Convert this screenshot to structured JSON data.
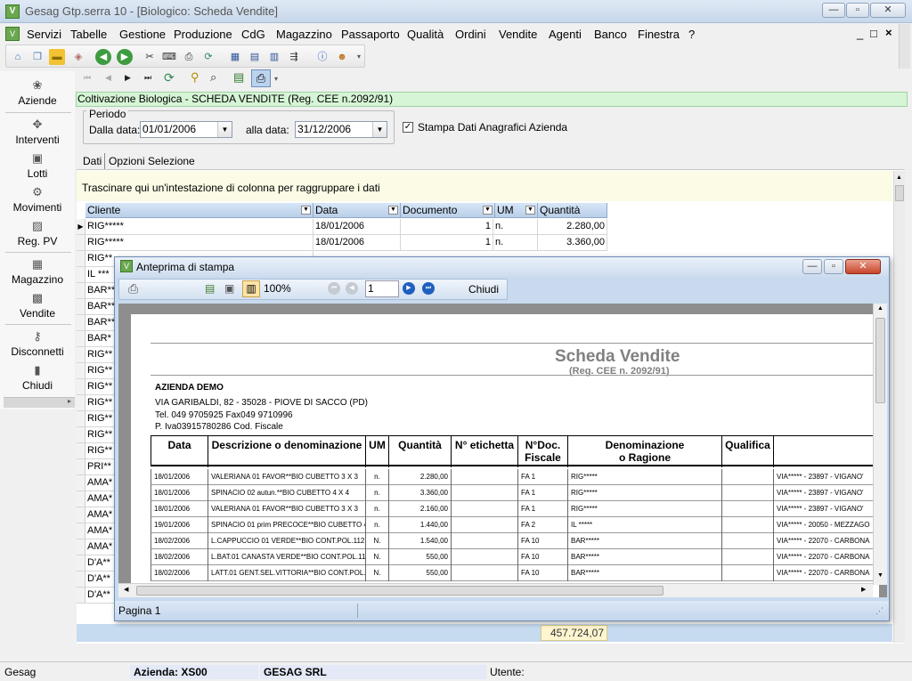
{
  "window": {
    "title": "Gesag Gtp.serra 10 - [Biologico: Scheda Vendite]",
    "mdi_controls": [
      "_",
      "□",
      "×"
    ]
  },
  "menu": [
    "Servizi",
    "Tabelle",
    "Gestione",
    "Produzione",
    "CdG",
    "Magazzino",
    "Passaporto",
    "Qualità",
    "Ordini",
    "Vendite",
    "Agenti",
    "Banco",
    "Finestra",
    "?"
  ],
  "sidebar": [
    {
      "label": "Aziende",
      "icon": "companies-icon"
    },
    {
      "label": "Interventi",
      "icon": "interventions-icon"
    },
    {
      "label": "Lotti",
      "icon": "lots-icon"
    },
    {
      "label": "Movimenti",
      "icon": "movements-icon"
    },
    {
      "label": "Reg. PV",
      "icon": "register-icon"
    },
    {
      "label": "Magazzino",
      "icon": "warehouse-icon"
    },
    {
      "label": "Vendite",
      "icon": "sales-icon"
    },
    {
      "label": "Disconnetti",
      "icon": "disconnect-icon"
    },
    {
      "label": "Chiudi",
      "icon": "close-door-icon"
    }
  ],
  "form": {
    "header": "Coltivazione Biologica - SCHEDA VENDITE (Reg. CEE n.2092/91)",
    "period_legend": "Periodo",
    "from_label": "Dalla data:",
    "from_value": "01/01/2006",
    "to_label": "alla data:",
    "to_value": "31/12/2006",
    "checkbox_label": "Stampa Dati Anagrafici Azienda",
    "checkbox_checked": true
  },
  "tabs": [
    "Dati",
    "Opzioni Selezione"
  ],
  "grid": {
    "group_hint": "Trascinare qui un'intestazione di colonna per raggruppare i dati",
    "columns": [
      "Cliente",
      "Data",
      "Documento",
      "UM",
      "Quantità"
    ],
    "rows": [
      [
        "RIG*****",
        "18/01/2006",
        "1",
        "n.",
        "2.280,00"
      ],
      [
        "RIG*****",
        "18/01/2006",
        "1",
        "n.",
        "3.360,00"
      ]
    ],
    "hidden_rows_clients": [
      "RIG**",
      "IL ***",
      "BAR**",
      "BAR**",
      "BAR**",
      "BAR*",
      "RIG**",
      "RIG**",
      "RIG**",
      "RIG**",
      "RIG**",
      "RIG**",
      "RIG**",
      "PRI**",
      "AMA*",
      "AMA*",
      "AMA*",
      "AMA*",
      "AMA*",
      "D'A**",
      "D'A**",
      "D'A**"
    ],
    "total": "457.724,07"
  },
  "status": {
    "app": "Gesag",
    "company": "Azienda: XS00",
    "company_name": "GESAG SRL",
    "user": "Utente:"
  },
  "preview": {
    "title": "Anteprima di stampa",
    "zoom": "100%",
    "page": "1",
    "close": "Chiudi",
    "status": "Pagina 1",
    "report": {
      "title": "Scheda Vendite",
      "subtitle": "(Reg. CEE n. 2092/91)",
      "company": "AZIENDA DEMO",
      "address": "VIA GARIBALDI, 82 - 35028 - PIOVE DI SACCO (PD)",
      "phone": "Tel. 049 9705925   Fax049 9710996",
      "vat": "P. Iva03915780286 Cod. Fiscale",
      "columns": [
        "Data",
        "Descrizione o denominazione",
        "UM",
        "Quantità",
        "N° etichetta",
        "N°Doc.\nFiscale",
        "Denominazione\no Ragione",
        "Qualifica",
        ""
      ],
      "rows": [
        [
          "18/01/2006",
          "VALERIANA 01 FAVOR**BIO CUBETTO 3 X 3",
          "n.",
          "2.280,00",
          "",
          "FA 1",
          "RIG*****",
          "",
          "VIA***** - 23897 - VIGANO'"
        ],
        [
          "18/01/2006",
          "SPINACIO 02 autun.**BIO CUBETTO 4 X 4",
          "n.",
          "3.360,00",
          "",
          "FA 1",
          "RIG*****",
          "",
          "VIA***** - 23897 - VIGANO'"
        ],
        [
          "18/01/2006",
          "VALERIANA 01 FAVOR**BIO CUBETTO 3 X 3",
          "n.",
          "2.160,00",
          "",
          "FA 1",
          "RIG*****",
          "",
          "VIA***** - 23897 - VIGANO'"
        ],
        [
          "19/01/2006",
          "SPINACIO 01 prim PRECOCE**BIO CUBETTO 4",
          "n.",
          "1.440,00",
          "",
          "FA 2",
          "IL *****",
          "",
          "VIA***** - 20050 - MEZZAGO"
        ],
        [
          "18/02/2006",
          "L.CAPPUCCIO 01 VERDE**BIO CONT.POL.112F",
          "N.",
          "1.540,00",
          "",
          "FA 10",
          "BAR*****",
          "",
          "VIA***** - 22070 - CARBONA"
        ],
        [
          "18/02/2006",
          "L.BAT.01 CANASTA VERDE**BIO CONT.POL.112",
          "N.",
          "550,00",
          "",
          "FA 10",
          "BAR*****",
          "",
          "VIA***** - 22070 - CARBONA"
        ],
        [
          "18/02/2006",
          "LATT.01 GENT.SEL.VITTORIA**BIO CONT.POL.",
          "N.",
          "550,00",
          "",
          "FA 10",
          "BAR*****",
          "",
          "VIA***** - 22070 - CARBONA"
        ]
      ]
    }
  }
}
